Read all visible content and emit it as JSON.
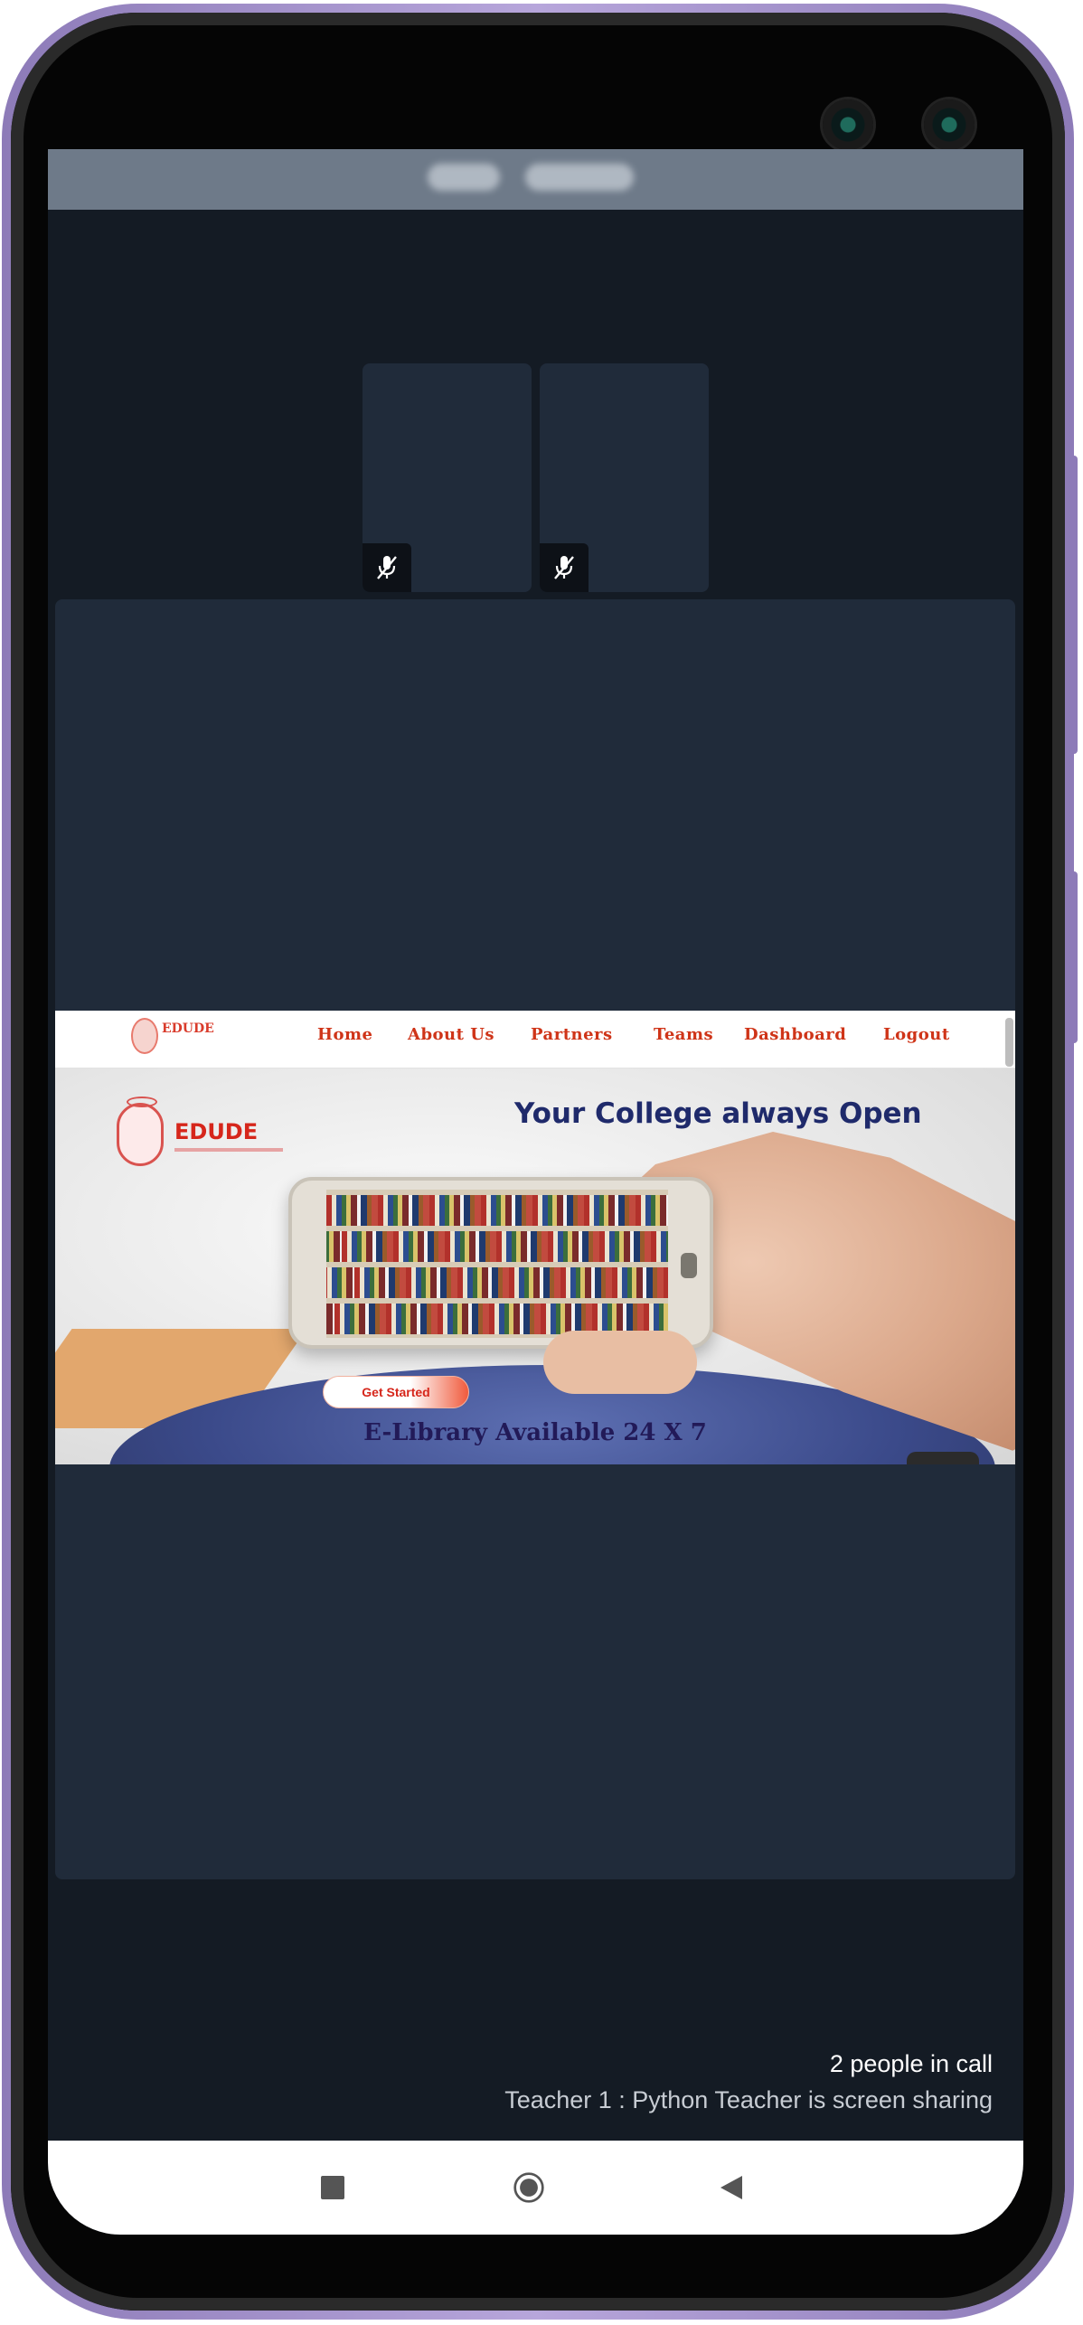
{
  "call": {
    "people_count": "2 people in call",
    "share_status": "Teacher 1 : Python Teacher is screen sharing"
  },
  "participants": [
    {
      "mic": "mic-off-icon"
    },
    {
      "mic": "mic-off-icon"
    }
  ],
  "shared_site": {
    "nav_logo": "EDUDE",
    "nav": [
      "Home",
      "About Us",
      "Partners",
      "Teams",
      "Dashboard",
      "Logout"
    ],
    "brand": "EDUDE",
    "title": "Your College always Open",
    "cta": "Get Started",
    "subtitle": "E-Library Available 24 X 7"
  },
  "system_nav": {
    "recents": "recents-icon",
    "home": "home-icon",
    "back": "back-icon"
  },
  "colors": {
    "call_background": "#141b24",
    "tile": "#202b3a",
    "top_bar": "#6e7a89",
    "brand_red": "#d6261b",
    "frame": "#8d7bb8"
  }
}
